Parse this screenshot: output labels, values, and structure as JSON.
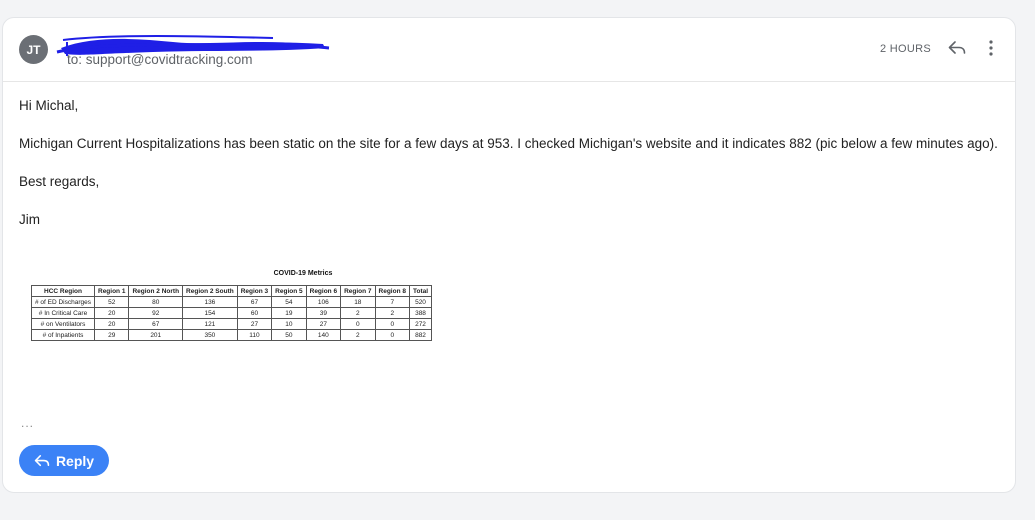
{
  "message": {
    "sender_initials": "JT",
    "to_line": "to: support@covidtracking.com",
    "time": "2 HOURS"
  },
  "body": {
    "greeting": "Hi Michal,",
    "paragraph": "Michigan Current Hospitalizations has been static on the site for a few days at 953.  I checked Michigan's website and it indicates 882 (pic below a few minutes ago).",
    "closing": "Best regards,",
    "signature": "Jim"
  },
  "attachment": {
    "title": "COVID-19 Metrics",
    "headers": [
      "HCC Region",
      "Region 1",
      "Region 2 North",
      "Region 2 South",
      "Region 3",
      "Region 5",
      "Region 6",
      "Region 7",
      "Region 8",
      "Total"
    ],
    "rows": [
      [
        "# of ED Discharges",
        "52",
        "80",
        "136",
        "67",
        "54",
        "106",
        "18",
        "7",
        "520"
      ],
      [
        "# In Critical Care",
        "20",
        "92",
        "154",
        "60",
        "19",
        "39",
        "2",
        "2",
        "388"
      ],
      [
        "# on Ventilators",
        "20",
        "67",
        "121",
        "27",
        "10",
        "27",
        "0",
        "0",
        "272"
      ],
      [
        "# of Inpatients",
        "29",
        "201",
        "350",
        "110",
        "50",
        "140",
        "2",
        "0",
        "882"
      ]
    ]
  },
  "collapsed_indicator": "...",
  "reply_button": {
    "label": "Reply"
  },
  "icons": {
    "reply": "reply-arrow-icon",
    "more": "vertical-dots-icon"
  },
  "colors": {
    "accent": "#3b82f6",
    "redaction": "#1f1fe6"
  }
}
